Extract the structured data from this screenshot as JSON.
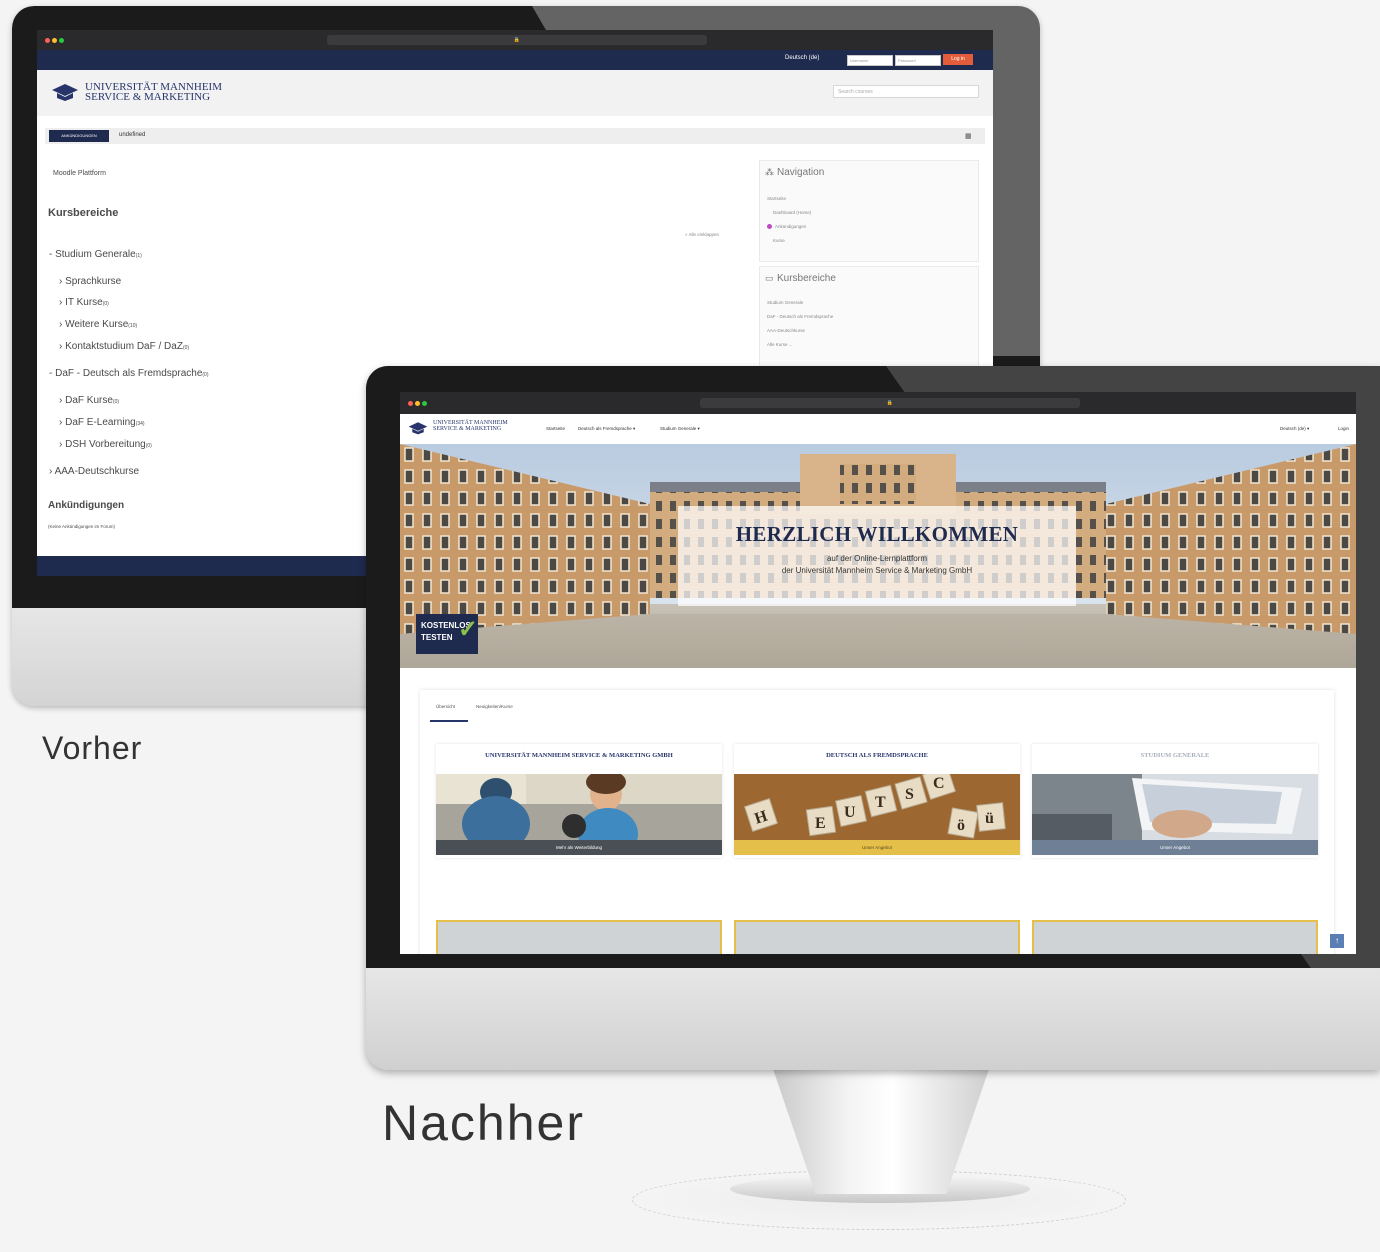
{
  "captions": {
    "before": "Vorher",
    "after": "Nachher"
  },
  "before": {
    "top_bar": {
      "language": "Deutsch (de)",
      "username_placeholder": "Username",
      "password_placeholder": "Password",
      "login_label": "Log in"
    },
    "header": {
      "logo_line1": "UNIVERSITÄT MANNHEIM",
      "logo_line2": "SERVICE & MARKETING",
      "search_placeholder": "Search courses"
    },
    "breadcrumb": {
      "button": "ANKÜNDIGUNGEN",
      "text": "undefined"
    },
    "main": {
      "site_name": "Moodle Plattform",
      "heading": "Kursbereiche",
      "collapse_link": "» Alle einklappen",
      "categories": [
        {
          "label": "Studium Generale",
          "count": "(1)"
        },
        {
          "label": "Sprachkurse",
          "count": ""
        },
        {
          "label": "IT Kurse",
          "count": "(0)"
        },
        {
          "label": "Weitere Kurse",
          "count": "(10)"
        },
        {
          "label": "Kontaktstudium DaF / DaZ",
          "count": "(0)"
        },
        {
          "label": "DaF - Deutsch als Fremdsprache",
          "count": "(0)"
        },
        {
          "label": "DaF Kurse",
          "count": "(0)"
        },
        {
          "label": "DaF E-Learning",
          "count": "(34)"
        },
        {
          "label": "DSH Vorbereitung",
          "count": "(0)"
        },
        {
          "label": "AAA-Deutschkurse",
          "count": ""
        }
      ],
      "announcements_heading": "Ankündigungen",
      "announcements_text": "(Keine Ankündigungen im Forum)"
    },
    "sidebar": {
      "nav_title": "Navigation",
      "nav_items": [
        "Startseite",
        "Dashboard (Home)",
        "Ankündigungen",
        "Kurse"
      ],
      "cat_title": "Kursbereiche",
      "cat_items": [
        "Studium Generale",
        "DaF - Deutsch als Fremdsprache",
        "AAA-Deutschkurse",
        "Alle Kurse ..."
      ]
    }
  },
  "after": {
    "header": {
      "logo_line1": "UNIVERSITÄT MANNHEIM",
      "logo_line2": "SERVICE & MARKETING",
      "menu": [
        "Startseite",
        "Deutsch als Fremdsprache ▾",
        "Studium Generale ▾"
      ],
      "language": "Deutsch (de) ▾",
      "login": "Login"
    },
    "hero": {
      "title": "HERZLICH WILLKOMMEN",
      "line1": "auf der Online-Lernplattform",
      "line2": "der Universität Mannheim Service & Marketing GmbH"
    },
    "badge": {
      "line1": "KOSTENLOS",
      "line2": "TESTEN",
      "check": "✓"
    },
    "tabs": [
      "Übersicht",
      "Neuigkeiten/Kurse"
    ],
    "cards": [
      {
        "title": "UNIVERSITÄT MANNHEIM SERVICE & MARKETING GMBH",
        "button": "Mehr als Weiterbildung"
      },
      {
        "title": "DEUTSCH ALS FREMDSPRACHE",
        "button": "Unser Angebot"
      },
      {
        "title": "STUDIUM GENERALE",
        "button": "Unser Angebot"
      }
    ],
    "scroll_top": "↑"
  },
  "colors": {
    "navy": "#1f2a4f",
    "login_orange": "#e35d3a",
    "yellow": "#e4c04a",
    "slate": "#6f8096"
  }
}
